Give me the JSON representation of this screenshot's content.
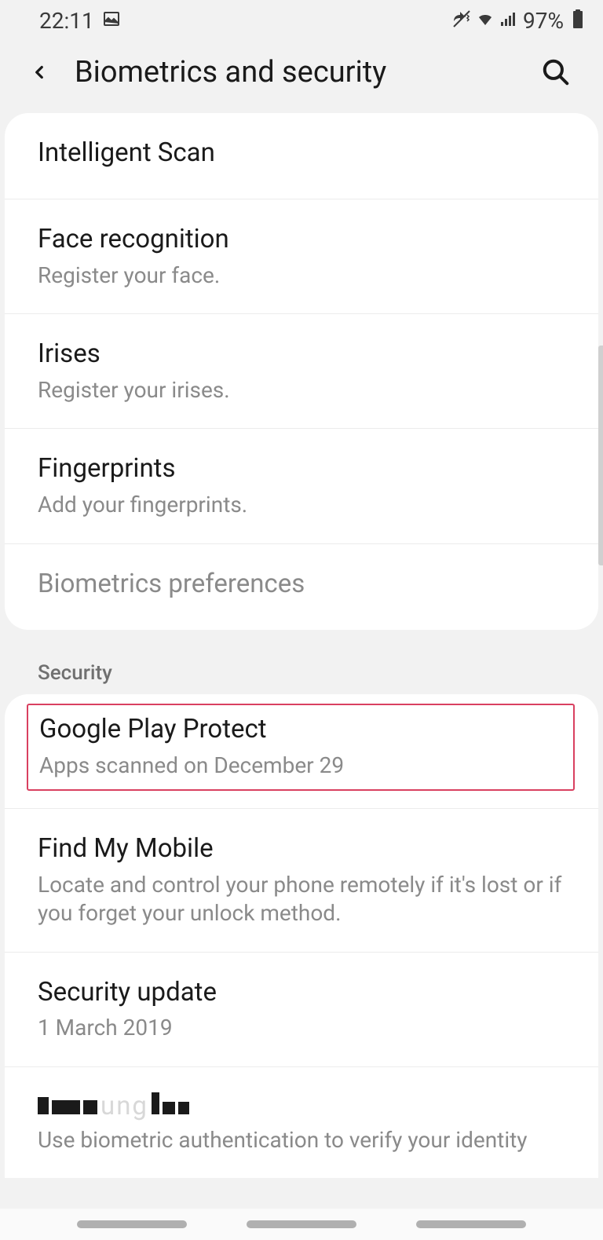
{
  "statusBar": {
    "time": "22:11",
    "batteryPercent": "97%"
  },
  "header": {
    "title": "Biometrics and security"
  },
  "biometrics": {
    "items": [
      {
        "title": "Intelligent Scan",
        "subtitle": ""
      },
      {
        "title": "Face recognition",
        "subtitle": "Register your face."
      },
      {
        "title": "Irises",
        "subtitle": "Register your irises."
      },
      {
        "title": "Fingerprints",
        "subtitle": "Add your fingerprints."
      },
      {
        "title": "Biometrics preferences",
        "subtitle": "",
        "disabled": true
      }
    ]
  },
  "security": {
    "header": "Security",
    "items": [
      {
        "title": "Google Play Protect",
        "subtitle": "Apps scanned on December 29",
        "highlighted": true
      },
      {
        "title": "Find My Mobile",
        "subtitle": "Locate and control your phone remotely if it's lost or if you forget your unlock method."
      },
      {
        "title": "Security update",
        "subtitle": "1 March 2019"
      },
      {
        "title": "████████",
        "subtitle": "Use biometric authentication to verify your identity"
      }
    ]
  }
}
